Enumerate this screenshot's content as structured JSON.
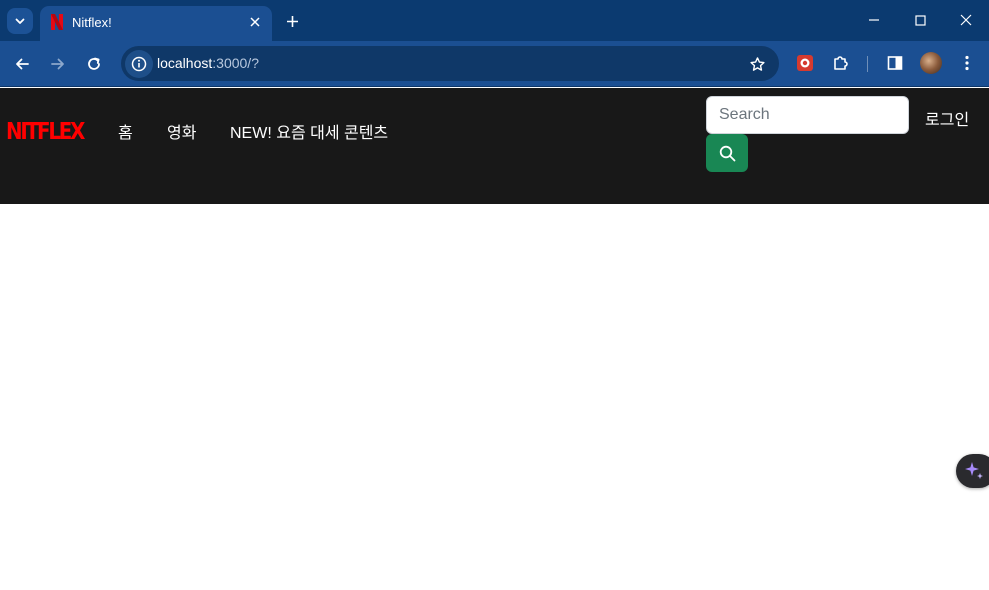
{
  "browser": {
    "tab": {
      "title": "Nitflex!"
    },
    "address": {
      "host": "localhost",
      "path": ":3000/?"
    },
    "icons": [
      "tab-search-icon",
      "netflix-favicon",
      "close-icon",
      "new-tab-icon",
      "minimize-icon",
      "maximize-icon",
      "window-close-icon",
      "back-icon",
      "forward-icon",
      "reload-icon",
      "site-info-icon",
      "star-icon",
      "extension-icon",
      "puzzle-icon",
      "side-panel-icon",
      "profile-avatar",
      "menu-icon"
    ]
  },
  "navbar": {
    "brand": "NITFLEX",
    "links": [
      "홈",
      "영화",
      "NEW! 요즘 대세 콘텐츠"
    ],
    "search_placeholder": "Search",
    "login": "로그인"
  },
  "colors": {
    "chrome_dark": "#0b3a70",
    "chrome_light": "#1b4f92",
    "navbar_bg": "#181818",
    "brand": "#ff0000",
    "search_button": "#198754"
  }
}
